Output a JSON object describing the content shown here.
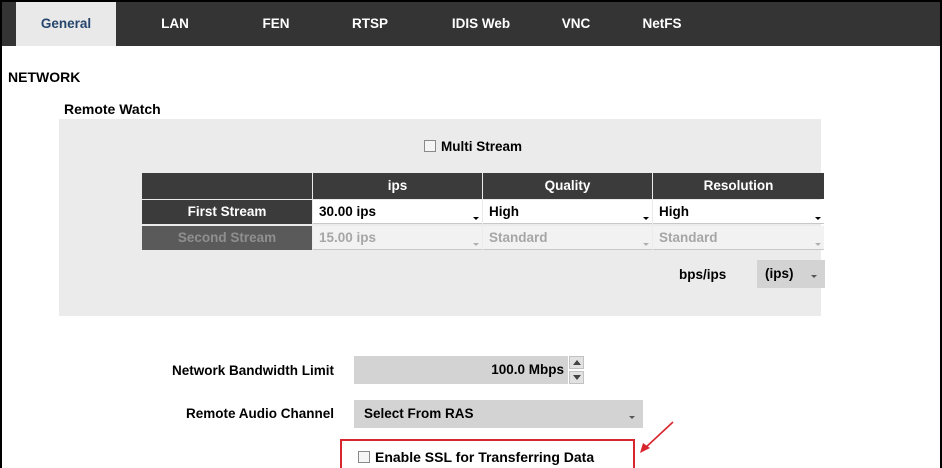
{
  "tabs": [
    {
      "label": "General",
      "active": true
    },
    {
      "label": "LAN"
    },
    {
      "label": "FEN"
    },
    {
      "label": "RTSP"
    },
    {
      "label": "IDIS Web"
    },
    {
      "label": "VNC"
    },
    {
      "label": "NetFS"
    }
  ],
  "section_title": "NETWORK",
  "remote_watch": {
    "title": "Remote Watch",
    "multi_stream_label": "Multi Stream",
    "multi_stream_checked": false,
    "columns": [
      "ips",
      "Quality",
      "Resolution"
    ],
    "rows": [
      {
        "label": "First Stream",
        "enabled": true,
        "ips": "30.00 ips",
        "quality": "High",
        "resolution": "High"
      },
      {
        "label": "Second Stream",
        "enabled": false,
        "ips": "15.00 ips",
        "quality": "Standard",
        "resolution": "Standard"
      }
    ],
    "bps_ips_label": "bps/ips",
    "bps_ips_value": "(ips)"
  },
  "network_bandwidth_limit": {
    "label": "Network Bandwidth Limit",
    "value": "100.0 Mbps"
  },
  "remote_audio_channel": {
    "label": "Remote Audio Channel",
    "value": "Select From RAS"
  },
  "ssl": {
    "label": "Enable SSL for Transferring Data",
    "checked": false
  },
  "colors": {
    "tab_bar": "#343434",
    "active_tab_bg": "#e9e9e9",
    "active_tab_text": "#26466d",
    "highlight_annotation": "#d8262e",
    "panel_bg": "#ebebeb"
  }
}
